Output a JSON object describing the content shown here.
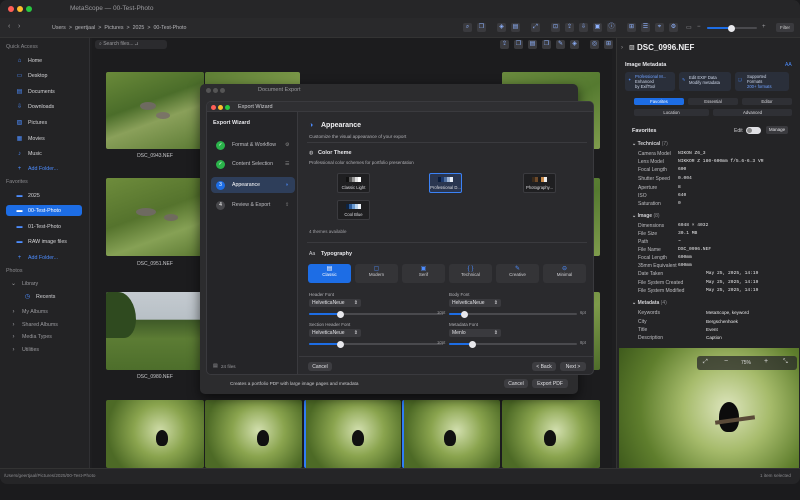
{
  "app": {
    "title": "MetaScope — 00-Test-Photo"
  },
  "toolbar": {
    "breadcrumb": [
      "Users",
      ">",
      "geertjaal",
      ">",
      "Pictures",
      ">",
      "2025",
      ">",
      "00-Test-Photo"
    ],
    "search_placeholder": "Search files...",
    "search_hint": "↵",
    "filter_label": "Filter"
  },
  "sidebar": {
    "quick_access": "Quick Access",
    "quick_items": [
      "Home",
      "Desktop",
      "Documents",
      "Downloads",
      "Pictures",
      "Movies",
      "Music"
    ],
    "add_folder": "Add Folder...",
    "favorites": "Favorites",
    "fav_items": [
      "2025",
      "00-Test-Photo",
      "01-Test-Photo",
      "RAW image files"
    ],
    "add_folder_2": "Add Folder...",
    "photos": "Photos",
    "library": "Library",
    "recents": "Recents",
    "collapsed": [
      "My Albums",
      "Shared Albums",
      "Media Types",
      "Utilities"
    ]
  },
  "grid": {
    "captions": [
      "DSC_0943.NEF",
      "DSC_0951.NEF",
      "DSC_0980.NEF"
    ]
  },
  "dialog": {
    "behind_title": "Document Export",
    "title": "Export Wizard",
    "left_header": "Export Wizard",
    "steps": [
      {
        "label": "Format & Workflow",
        "num": "✓"
      },
      {
        "label": "Content Selection",
        "num": "✓"
      },
      {
        "label": "Appearance",
        "num": "3"
      },
      {
        "label": "Review & Export",
        "num": "4"
      }
    ],
    "files_count": "24 files",
    "section_title": "Appearance",
    "section_subtitle": "Customize the visual appearance of your export",
    "color_theme": "Color Theme",
    "color_theme_sub": "Professional color schemes for portfolio presentation",
    "themes": [
      "Classic Light",
      "Professional D...",
      "Photography...",
      "Cool Blue"
    ],
    "themes_available": "4 themes available",
    "typography": "Typography",
    "fonts": [
      "Classic",
      "Modern",
      "Serif",
      "Technical",
      "Creative",
      "Minimal"
    ],
    "header_font": "Header Font",
    "header_font_value": "HelveticaNeue",
    "body_font": "Body Font",
    "body_font_value": "HelveticaNeue",
    "section_header_font": "Section Header Font",
    "section_header_value": "HelveticaNeue",
    "metadata_font": "Metadata Font",
    "metadata_font_value": "Menlo",
    "size_min": "10pt",
    "size_max": "6pt",
    "size_max_right": "8pt",
    "cancel": "Cancel",
    "back": "< Back",
    "next": "Next >",
    "footer_desc": "Creates a portfolio PDF with large image pages and metadata",
    "footer_cancel": "Cancel",
    "export_pdf": "Export PDF"
  },
  "inspector": {
    "filename": "DSC_0996.NEF",
    "image_metadata": "Image Metadata",
    "aa": "AA",
    "features": [
      {
        "l1": "Professional M...",
        "l2": "Enhanced",
        "l3": "by ExifTool"
      },
      {
        "l1": "Edit EXIF Data",
        "l2": "Modify metadata",
        "l3": ""
      },
      {
        "l1": "Supported",
        "l2": "Formats",
        "l3": "200+ formats"
      }
    ],
    "tabs_row1": [
      "Favorites",
      "Essential",
      "Editor"
    ],
    "tabs_row2": [
      "Location",
      "Advanced"
    ],
    "favorites_label": "Favorites",
    "edit_label": "Edit",
    "manage_label": "Manage",
    "technical_header": "Technical",
    "technical_count": "(7)",
    "technical": [
      {
        "k": "Camera Model",
        "v": "NIKON Z6_3"
      },
      {
        "k": "Lens Model",
        "v": "NIKKOR Z 180-600mm f/5.6-6.3 VR"
      },
      {
        "k": "Focal Length",
        "v": "600"
      },
      {
        "k": "Shutter Speed",
        "v": "0.004"
      },
      {
        "k": "Aperture",
        "v": "8"
      },
      {
        "k": "ISO",
        "v": "640"
      },
      {
        "k": "Saturation",
        "v": "0"
      }
    ],
    "image_header": "Image",
    "image_count": "(8)",
    "image": [
      {
        "k": "Dimensions",
        "v": "6048 × 4032"
      },
      {
        "k": "File Size",
        "v": "30.1 MB"
      },
      {
        "k": "Path",
        "v": "~"
      },
      {
        "k": "File Name",
        "v": "DSC_0996.NEF"
      },
      {
        "k": "Focal Length",
        "v": "600mm"
      },
      {
        "k": "35mm Equivalent",
        "v": "600mm"
      },
      {
        "k": "Date Taken",
        "v": "May 25, 2025, 14:19"
      },
      {
        "k": "File System Created",
        "v": "May 25, 2025, 14:19"
      },
      {
        "k": "File System Modified",
        "v": "May 25, 2025, 14:19"
      }
    ],
    "metadata_header": "Metadata",
    "metadata_count": "(4)",
    "metadata": [
      {
        "k": "Keywords",
        "v": "MetaScope, keyword"
      },
      {
        "k": "City",
        "v": "Bergschenhoek"
      },
      {
        "k": "Title",
        "v": "Event"
      },
      {
        "k": "Description",
        "v": "Caption"
      }
    ],
    "zoom": "75%"
  },
  "status": {
    "path": "/Users/geertjaal/Pictures/2025/00-Test-Photo",
    "selection": "1 item selected"
  },
  "colors": {
    "accent": "#1d6de5",
    "bg": "#1e1e20"
  }
}
